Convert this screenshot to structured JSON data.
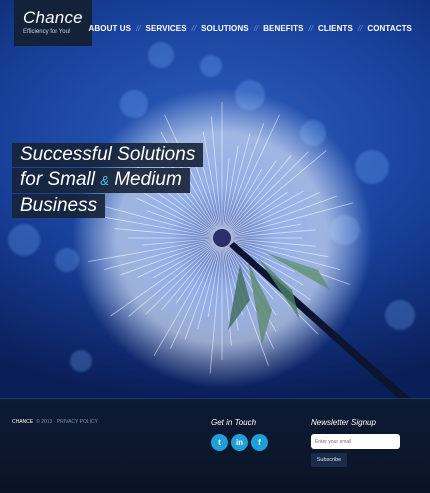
{
  "brand": {
    "name": "Chance",
    "tagline": "Efficiency for You!"
  },
  "nav": {
    "items": [
      "ABOUT US",
      "SERVICES",
      "SOLUTIONS",
      "BENEFITS",
      "CLIENTS",
      "CONTACTS"
    ],
    "separator": "//"
  },
  "hero": {
    "line1": "Successful Solutions",
    "line2_start": "for Small",
    "line2_amp": "&",
    "line2_end": "Medium",
    "line3": "Business"
  },
  "footer": {
    "brand": "CHANCE",
    "copyright": "© 2013 · PRIVACY POLICY",
    "get_in_touch": "Get in Touch",
    "socials": [
      {
        "icon": "twitter-icon",
        "glyph": "t"
      },
      {
        "icon": "linkedin-icon",
        "glyph": "in"
      },
      {
        "icon": "facebook-icon",
        "glyph": "f"
      }
    ],
    "newsletter_title": "Newsletter Signup",
    "email_placeholder": "Enter your email",
    "subscribe_label": "Subscribe"
  },
  "colors": {
    "accent": "#1e9fda",
    "label_bg": "#162236",
    "amp": "#4cc0ea"
  }
}
